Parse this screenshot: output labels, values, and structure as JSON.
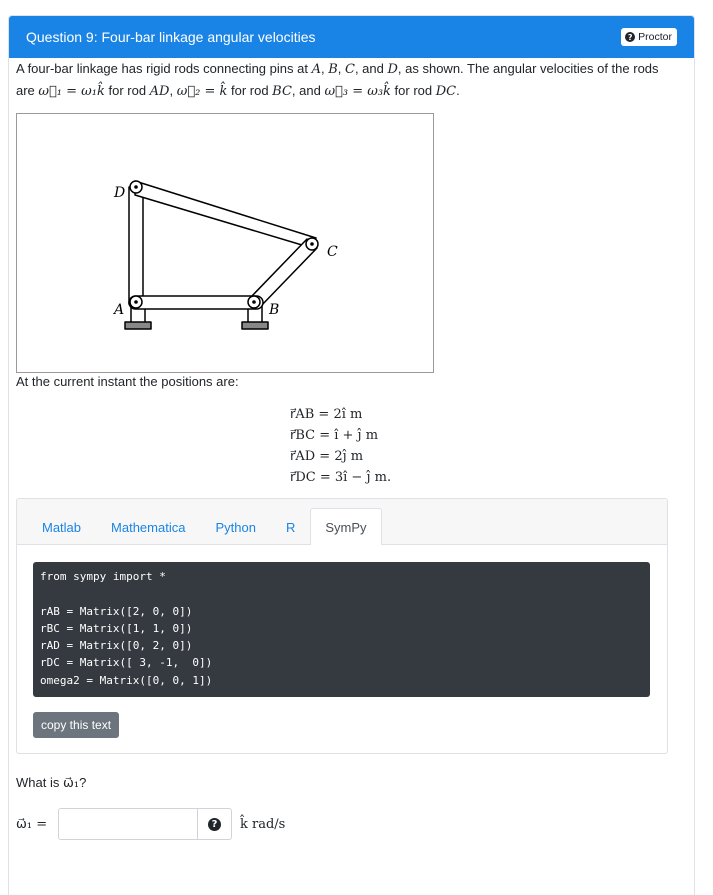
{
  "header": {
    "title": "Question 9: Four-bar linkage angular velocities",
    "proctor_label": "Proctor"
  },
  "intro": {
    "t1": "A four-bar linkage has rigid rods connecting pins at ",
    "A": "A",
    "sep1": ", ",
    "B": "B",
    "sep2": ", ",
    "C": "C",
    "sep3": ", and ",
    "D": "D",
    "t2": ", as shown. The angular velocities of the rods are ",
    "w1": "ω⃗₁ = ω₁k̂",
    "t3": " for rod ",
    "AD": "AD",
    "t4": ", ",
    "w2": "ω⃗₂ = k̂",
    "t5": " for rod ",
    "BC": "BC",
    "t6": ", and ",
    "w3": "ω⃗₃ = ω₃k̂",
    "t7": " for rod ",
    "DC": "DC",
    "t8": "."
  },
  "figure": {
    "labels": {
      "A": "A",
      "B": "B",
      "C": "C",
      "D": "D"
    }
  },
  "positions_label": "At the current instant the positions are:",
  "equations": [
    "r⃗AB = 2î m",
    "r⃗BC = î + ĵ m",
    "r⃗AD = 2ĵ m",
    "r⃗DC = 3î − ĵ m."
  ],
  "tabs": [
    "Matlab",
    "Mathematica",
    "Python",
    "R",
    "SymPy"
  ],
  "active_tab": "SymPy",
  "code": "from sympy import *\n\nrAB = Matrix([2, 0, 0])\nrBC = Matrix([1, 1, 0])\nrAD = Matrix([0, 2, 0])\nrDC = Matrix([ 3, -1,  0])\nomega2 = Matrix([0, 0, 1])",
  "copy_button_label": "copy this text",
  "question": {
    "prefix": "What is ",
    "symbol": "ω⃗₁",
    "suffix": "?"
  },
  "answer": {
    "label": "ω⃗₁ =",
    "value": "",
    "placeholder": "",
    "units": "k̂ rad/s"
  },
  "colors": {
    "header_bg": "#1a84e6",
    "link": "#1a84e6",
    "code_bg": "#343a40",
    "copy_button_bg": "#6c757d"
  }
}
